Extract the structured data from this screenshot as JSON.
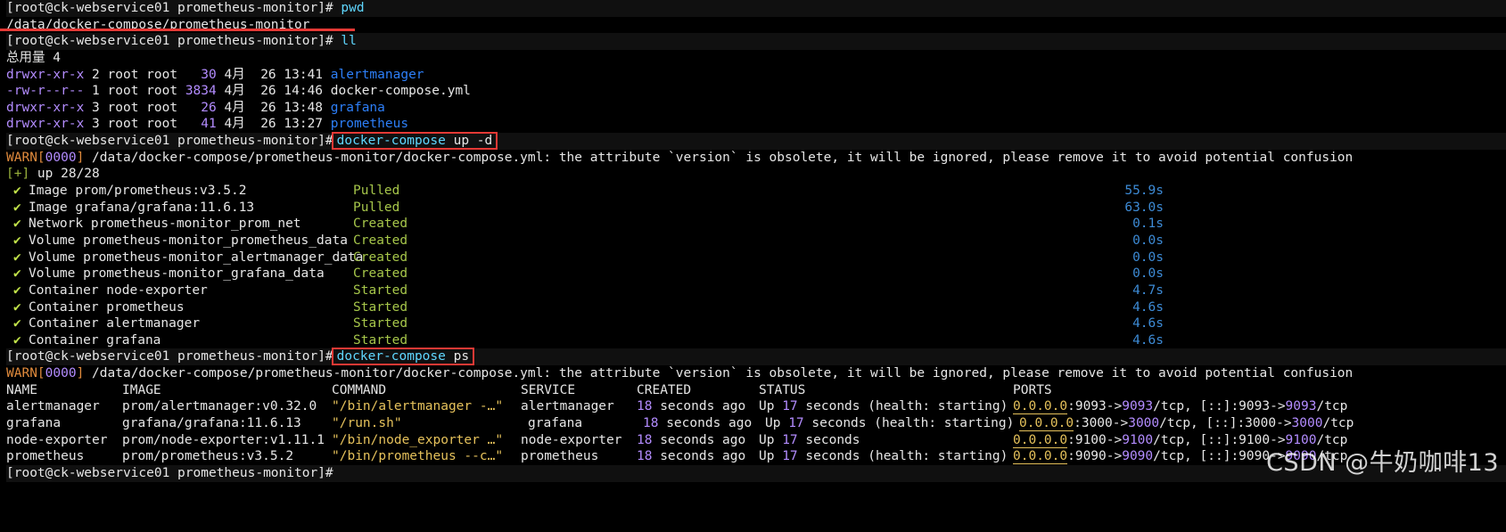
{
  "terminal": {
    "prompt": "[root@ck-webservice01 prometheus-monitor]",
    "prompt_symbol": "#",
    "commands": {
      "pwd": "pwd",
      "ll": "ll",
      "up": "docker-compose up -d",
      "up_cmd": "docker-compose",
      "up_args": " up -d",
      "ps_cmd": "docker-compose",
      "ps_args": " ps"
    },
    "pwd_output": "/data/docker-compose/prometheus-monitor",
    "ll_total": "总用量 4",
    "listing": [
      {
        "perms": "drwxr-xr-x",
        "links": "2",
        "owner": "root",
        "group": "root",
        "size": "  30",
        "month": "4月",
        "day": "26",
        "time": "13:41",
        "name": "alertmanager",
        "is_dir": true
      },
      {
        "perms": "-rw-r--r--",
        "links": "1",
        "owner": "root",
        "group": "root",
        "size": "3834",
        "month": "4月",
        "day": "26",
        "time": "14:46",
        "name": "docker-compose.yml",
        "is_dir": false
      },
      {
        "perms": "drwxr-xr-x",
        "links": "3",
        "owner": "root",
        "group": "root",
        "size": "  26",
        "month": "4月",
        "day": "26",
        "time": "13:48",
        "name": "grafana",
        "is_dir": true
      },
      {
        "perms": "drwxr-xr-x",
        "links": "3",
        "owner": "root",
        "group": "root",
        "size": "  41",
        "month": "4月",
        "day": "26",
        "time": "13:27",
        "name": "prometheus",
        "is_dir": true
      }
    ],
    "warn_prefix": "WARN[",
    "warn_code": "0000",
    "warn_suffix": "]",
    "warn_text": " /data/docker-compose/prometheus-monitor/docker-compose.yml: the attribute `version` is obsolete, it will be ignored, please remove it to avoid potential confusion",
    "up_progress_prefix": "[+]",
    "up_progress": " up 28/28",
    "up_items": [
      {
        "check": "✔",
        "name": "Image prom/prometheus:v3.5.2",
        "status": "Pulled",
        "time": "55.9s"
      },
      {
        "check": "✔",
        "name": "Image grafana/grafana:11.6.13",
        "status": "Pulled",
        "time": "63.0s"
      },
      {
        "check": "✔",
        "name": "Network prometheus-monitor_prom_net",
        "status": "Created",
        "time": "0.1s"
      },
      {
        "check": "✔",
        "name": "Volume prometheus-monitor_prometheus_data",
        "status": "Created",
        "time": "0.0s"
      },
      {
        "check": "✔",
        "name": "Volume prometheus-monitor_alertmanager_data",
        "status": "Created",
        "time": "0.0s"
      },
      {
        "check": "✔",
        "name": "Volume prometheus-monitor_grafana_data",
        "status": "Created",
        "time": "0.0s"
      },
      {
        "check": "✔",
        "name": "Container node-exporter",
        "status": "Started",
        "time": "4.7s"
      },
      {
        "check": "✔",
        "name": "Container prometheus",
        "status": "Started",
        "time": "4.6s"
      },
      {
        "check": "✔",
        "name": "Container alertmanager",
        "status": "Started",
        "time": "4.6s"
      },
      {
        "check": "✔",
        "name": "Container grafana",
        "status": "Started",
        "time": "4.6s"
      }
    ],
    "ps_headers": {
      "name": "NAME",
      "image": "IMAGE",
      "command": "COMMAND",
      "service": "SERVICE",
      "created": "CREATED",
      "status": "STATUS",
      "ports": "PORTS"
    },
    "ps_rows": [
      {
        "name": "alertmanager",
        "image": "prom/alertmanager:v0.32.0",
        "command": "\"/bin/alertmanager -…\"",
        "service": "alertmanager",
        "created_num": "18",
        "created_rest": " seconds ago",
        "status_pre": "Up ",
        "status_num": "17",
        "status_rest": " seconds (health: starting)",
        "port_host": "0.0.0.0",
        "port_a": ":9093->",
        "port_b": "9093",
        "port_c": "/tcp, [::]:9093->",
        "port_d": "9093",
        "port_e": "/tcp"
      },
      {
        "name": "grafana",
        "image": "grafana/grafana:11.6.13",
        "command": "\"/run.sh\"",
        "service": "grafana",
        "created_num": "18",
        "created_rest": " seconds ago",
        "status_pre": "Up ",
        "status_num": "17",
        "status_rest": " seconds (health: starting)",
        "port_host": "0.0.0.0",
        "port_a": ":3000->",
        "port_b": "3000",
        "port_c": "/tcp, [::]:3000->",
        "port_d": "3000",
        "port_e": "/tcp"
      },
      {
        "name": "node-exporter",
        "image": "prom/node-exporter:v1.11.1",
        "command": "\"/bin/node_exporter …\"",
        "service": "node-exporter",
        "created_num": "18",
        "created_rest": " seconds ago",
        "status_pre": "Up ",
        "status_num": "17",
        "status_rest": " seconds",
        "port_host": "0.0.0.0",
        "port_a": ":9100->",
        "port_b": "9100",
        "port_c": "/tcp, [::]:9100->",
        "port_d": "9100",
        "port_e": "/tcp"
      },
      {
        "name": "prometheus",
        "image": "prom/prometheus:v3.5.2",
        "command": "\"/bin/prometheus --c…\"",
        "service": "prometheus",
        "created_num": "18",
        "created_rest": " seconds ago",
        "status_pre": "Up ",
        "status_num": "17",
        "status_rest": " seconds (health: starting)",
        "port_host": "0.0.0.0",
        "port_a": ":9090->",
        "port_b": "9090",
        "port_c": "/tcp, [::]:9090->",
        "port_d": "9090",
        "port_e": "/tcp"
      }
    ]
  },
  "watermark": "CSDN @牛奶咖啡13",
  "colors": {
    "background": "#000000",
    "prompt_bar": "#101010",
    "highlight_box": "#e53935",
    "directory": "#2d7ff9",
    "status_green": "#a6c64a",
    "number_purple": "#b38cff",
    "port_yellow": "#e5c15b"
  }
}
